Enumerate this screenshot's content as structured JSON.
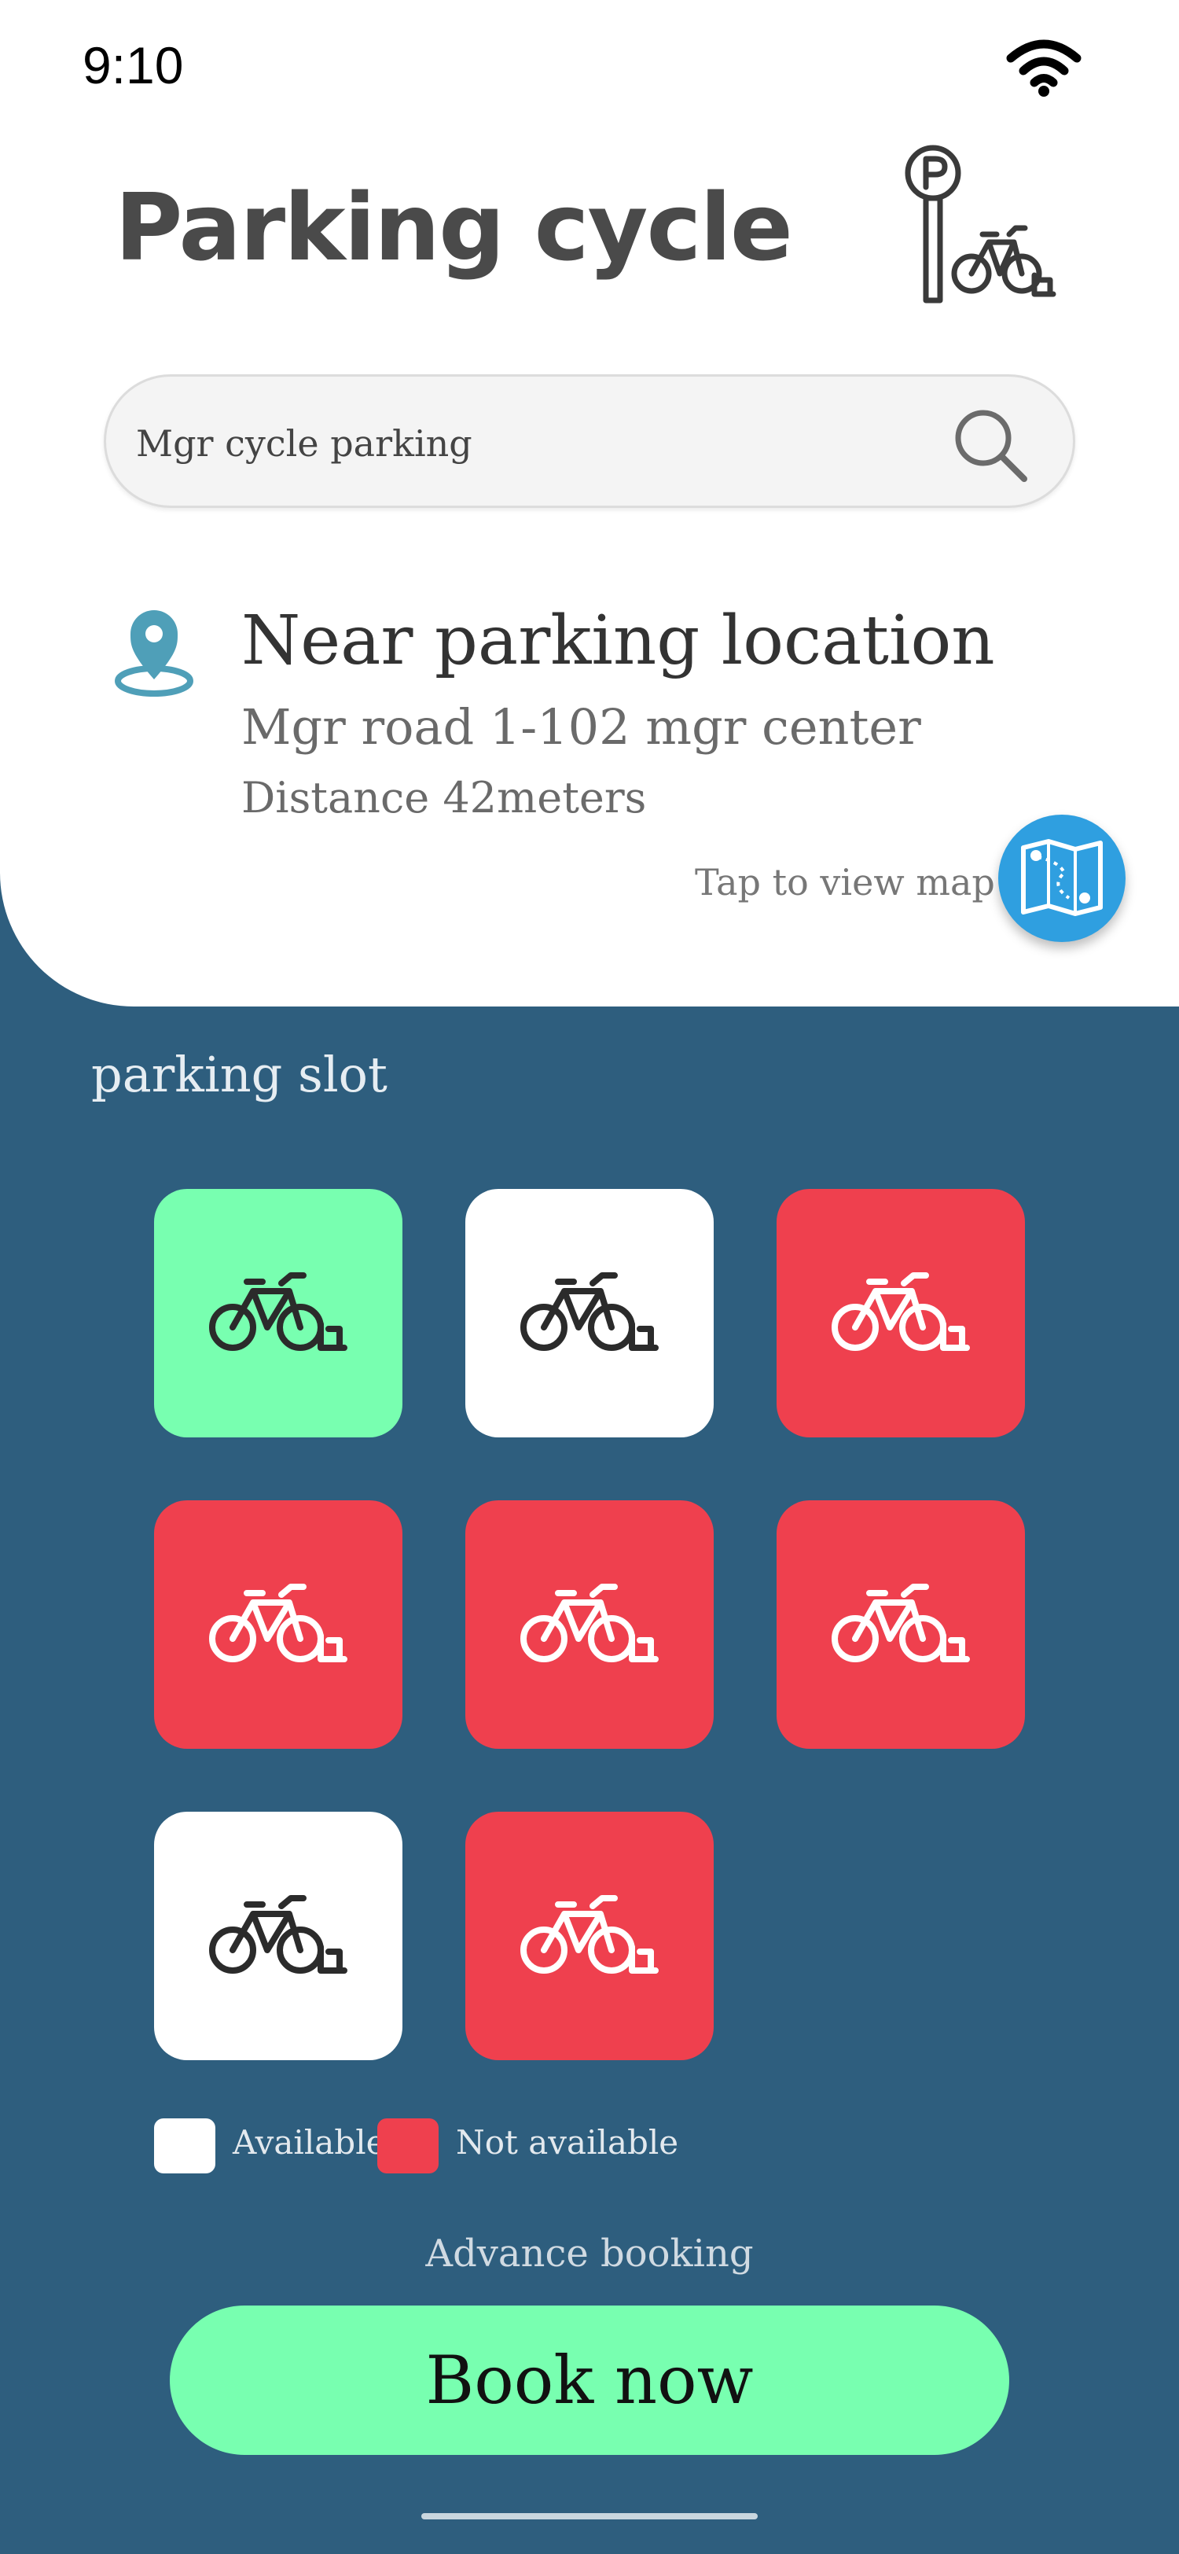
{
  "status_bar": {
    "time": "9:10",
    "wifi_icon": "wifi-icon"
  },
  "header": {
    "title": "Parking cycle",
    "logo_icon": "parking-bicycle-icon"
  },
  "search": {
    "value": "Mgr cycle parking",
    "icon": "search-icon"
  },
  "location": {
    "icon": "location-pin-icon",
    "title": "Near parking location",
    "address": "Mgr road 1-102 mgr center",
    "distance": "Distance 42meters",
    "map_hint": "Tap to view map",
    "map_icon": "folded-map-icon"
  },
  "slots": {
    "heading": "parking slot",
    "items": [
      {
        "status": "selected",
        "bg": "#78ffb0",
        "icon_color": "#2b2b2b"
      },
      {
        "status": "available",
        "bg": "#ffffff",
        "icon_color": "#2b2b2b"
      },
      {
        "status": "not_available",
        "bg": "#ef404e",
        "icon_color": "#ffffff"
      },
      {
        "status": "not_available",
        "bg": "#ef404e",
        "icon_color": "#ffffff"
      },
      {
        "status": "not_available",
        "bg": "#ef404e",
        "icon_color": "#ffffff"
      },
      {
        "status": "not_available",
        "bg": "#ef404e",
        "icon_color": "#ffffff"
      },
      {
        "status": "available",
        "bg": "#ffffff",
        "icon_color": "#2b2b2b"
      },
      {
        "status": "not_available",
        "bg": "#ef404e",
        "icon_color": "#ffffff"
      }
    ]
  },
  "legend": {
    "available": {
      "label": "Available",
      "color": "#ffffff"
    },
    "not_available": {
      "label": "Not available",
      "color": "#ef404e"
    }
  },
  "booking": {
    "advance_label": "Advance booking",
    "book_label": "Book now"
  },
  "colors": {
    "background": "#2e5e7e",
    "accent_green": "#78ffb0",
    "unavailable_red": "#ef404e",
    "map_button_blue": "#2f9fe0"
  }
}
